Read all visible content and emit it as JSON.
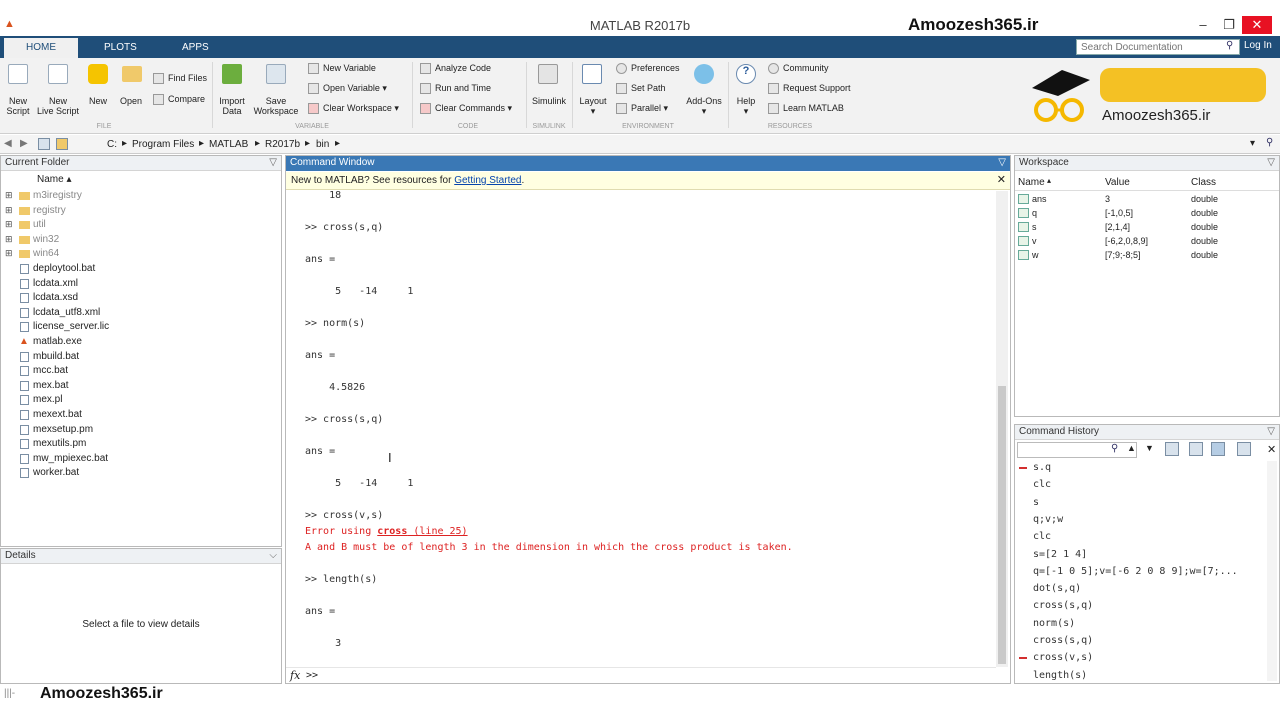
{
  "window": {
    "title": "MATLAB R2017b",
    "brand": "Amoozesh365.ir"
  },
  "tabs": [
    {
      "label": "HOME"
    },
    {
      "label": "PLOTS"
    },
    {
      "label": "APPS"
    }
  ],
  "toolbar": {
    "search_placeholder": "Search Documentation",
    "login": "Log In"
  },
  "ribbon": {
    "new_script": [
      "New",
      "Script"
    ],
    "new_live_script": [
      "New",
      "Live Script"
    ],
    "new": "New",
    "open": "Open",
    "find_files": "Find Files",
    "compare": "Compare",
    "import_data": [
      "Import",
      "Data"
    ],
    "save_workspace": [
      "Save",
      "Workspace"
    ],
    "new_variable": "New Variable",
    "open_variable": "Open Variable",
    "clear_workspace": "Clear Workspace",
    "analyze_code": "Analyze Code",
    "run_and_time": "Run and Time",
    "clear_commands": "Clear Commands",
    "simulink": "Simulink",
    "layout": "Layout",
    "preferences": "Preferences",
    "set_path": "Set Path",
    "parallel": "Parallel",
    "addons": "Add-Ons",
    "help": "Help",
    "community": "Community",
    "request_support": "Request Support",
    "learn_matlab": "Learn MATLAB",
    "groups": [
      "FILE",
      "VARIABLE",
      "CODE",
      "SIMULINK",
      "ENVIRONMENT",
      "RESOURCES"
    ],
    "logo_text": "Amoozesh365.ir"
  },
  "path": {
    "segments": [
      "C:",
      "Program Files",
      "MATLAB",
      "R2017b",
      "bin"
    ]
  },
  "current_folder": {
    "title": "Current Folder",
    "column": "Name",
    "items": [
      {
        "name": "m3iregistry",
        "type": "folder"
      },
      {
        "name": "registry",
        "type": "folder"
      },
      {
        "name": "util",
        "type": "folder"
      },
      {
        "name": "win32",
        "type": "folder"
      },
      {
        "name": "win64",
        "type": "folder"
      },
      {
        "name": "deploytool.bat",
        "type": "file"
      },
      {
        "name": "lcdata.xml",
        "type": "file"
      },
      {
        "name": "lcdata.xsd",
        "type": "file"
      },
      {
        "name": "lcdata_utf8.xml",
        "type": "file"
      },
      {
        "name": "license_server.lic",
        "type": "file"
      },
      {
        "name": "matlab.exe",
        "type": "exe"
      },
      {
        "name": "mbuild.bat",
        "type": "file"
      },
      {
        "name": "mcc.bat",
        "type": "file"
      },
      {
        "name": "mex.bat",
        "type": "file"
      },
      {
        "name": "mex.pl",
        "type": "file"
      },
      {
        "name": "mexext.bat",
        "type": "file"
      },
      {
        "name": "mexsetup.pm",
        "type": "file"
      },
      {
        "name": "mexutils.pm",
        "type": "file"
      },
      {
        "name": "mw_mpiexec.bat",
        "type": "file"
      },
      {
        "name": "worker.bat",
        "type": "file"
      }
    ]
  },
  "details": {
    "title": "Details",
    "placeholder": "Select a file to view details"
  },
  "command_window": {
    "title": "Command Window",
    "banner_text": "New to MATLAB? See resources for ",
    "banner_link": "Getting Started",
    "banner_end": ".",
    "lines": [
      {
        "text": "    18",
        "style": "normal"
      },
      {
        "text": ">> cross(s,q)",
        "style": "normal"
      },
      {
        "text": "ans =",
        "style": "normal"
      },
      {
        "text": "     5   -14     1",
        "style": "normal"
      },
      {
        "text": ">> norm(s)",
        "style": "normal"
      },
      {
        "text": "ans =",
        "style": "normal"
      },
      {
        "text": "    4.5826",
        "style": "normal"
      },
      {
        "text": ">> cross(s,q)",
        "style": "normal"
      },
      {
        "text": "ans =",
        "style": "normal"
      },
      {
        "text": "     5   -14     1",
        "style": "normal"
      },
      {
        "text": ">> cross(v,s)",
        "style": "normal"
      },
      {
        "text": "Error using ",
        "style": "err",
        "link": "cross",
        "suffix": " (line 25)"
      },
      {
        "text": "A and B must be of length 3 in the dimension in which the cross product is taken.",
        "style": "err"
      },
      {
        "text": ">> length(s)",
        "style": "normal"
      },
      {
        "text": "ans =",
        "style": "normal"
      },
      {
        "text": "     3",
        "style": "normal"
      }
    ],
    "prompt": ">>",
    "fx": "fx"
  },
  "workspace": {
    "title": "Workspace",
    "columns": [
      "Name",
      "Value",
      "Class"
    ],
    "rows": [
      {
        "name": "ans",
        "value": "3",
        "class": "double"
      },
      {
        "name": "q",
        "value": "[-1,0,5]",
        "class": "double"
      },
      {
        "name": "s",
        "value": "[2,1,4]",
        "class": "double"
      },
      {
        "name": "v",
        "value": "[-6,2,0,8,9]",
        "class": "double"
      },
      {
        "name": "w",
        "value": "[7;9;-8;5]",
        "class": "double"
      }
    ]
  },
  "history": {
    "title": "Command History",
    "items": [
      {
        "text": "s.q",
        "marker": true
      },
      {
        "text": "clc",
        "marker": false
      },
      {
        "text": "s",
        "marker": false
      },
      {
        "text": "q;v;w",
        "marker": false
      },
      {
        "text": "clc",
        "marker": false
      },
      {
        "text": "s=[2 1 4]",
        "marker": false
      },
      {
        "text": "q=[-1 0 5];v=[-6 2 0 8 9];w=[7;...",
        "marker": false
      },
      {
        "text": "dot(s,q)",
        "marker": false
      },
      {
        "text": "cross(s,q)",
        "marker": false
      },
      {
        "text": "norm(s)",
        "marker": false
      },
      {
        "text": "cross(s,q)",
        "marker": false
      },
      {
        "text": "cross(v,s)",
        "marker": true
      },
      {
        "text": "length(s)",
        "marker": false
      }
    ]
  },
  "status": {
    "text": "Amoozesh365.ir",
    "indicator": "|||-"
  },
  "colors": {
    "tabbar": "#1f4e79",
    "error": "#dd2222",
    "history_marker": "#d32f2f",
    "banner": "#ffffe1"
  }
}
